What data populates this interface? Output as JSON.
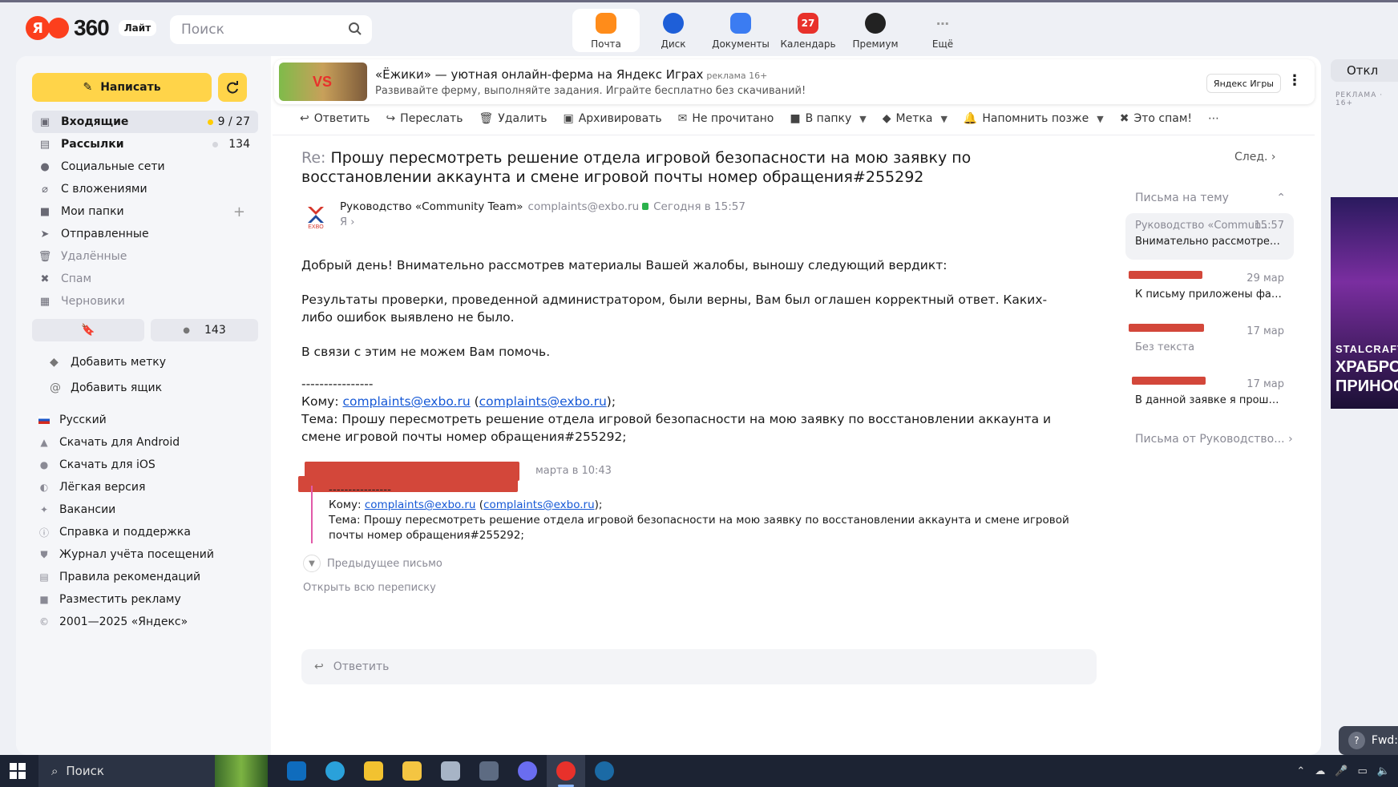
{
  "header": {
    "logo_text": "360",
    "logo_ya": "Я",
    "lite_label": "Лайт",
    "search_placeholder": "Поиск",
    "services": [
      {
        "label": "Почта",
        "icon": "mail-icon",
        "color": "#ff8c1a"
      },
      {
        "label": "Диск",
        "icon": "disk-icon",
        "color": "#1e5fd8"
      },
      {
        "label": "Документы",
        "icon": "documents-icon",
        "color": "#3b7cf2"
      },
      {
        "label": "Календарь",
        "icon": "calendar-icon",
        "color": "#e8312b",
        "badge": "27"
      },
      {
        "label": "Премиум",
        "icon": "premium-icon",
        "color": "#222222"
      },
      {
        "label": "Ещё",
        "icon": "more-icon",
        "color": "#999999"
      }
    ]
  },
  "sidebar": {
    "compose_label": "Написать",
    "folders": [
      {
        "label": "Входящие",
        "count": "9 / 27",
        "icon": "inbox-icon",
        "active": true
      },
      {
        "label": "Рассылки",
        "count": "134",
        "icon": "newsletters-icon"
      },
      {
        "label": "Социальные сети",
        "icon": "social-icon"
      },
      {
        "label": "С вложениями",
        "icon": "attachment-icon"
      },
      {
        "label": "Мои папки",
        "icon": "folder-icon"
      },
      {
        "label": "Отправленные",
        "icon": "sent-icon"
      },
      {
        "label": "Удалённые",
        "icon": "trash-icon"
      },
      {
        "label": "Спам",
        "icon": "spam-icon"
      },
      {
        "label": "Черновики",
        "icon": "drafts-icon"
      }
    ],
    "unread_count": "143",
    "add_label": "Добавить метку",
    "add_mailbox": "Добавить ящик",
    "links": [
      {
        "label": "Русский",
        "icon": "flag-ru-icon"
      },
      {
        "label": "Скачать для Android",
        "icon": "android-icon"
      },
      {
        "label": "Скачать для iOS",
        "icon": "apple-icon"
      },
      {
        "label": "Лёгкая версия",
        "icon": "light-version-icon"
      },
      {
        "label": "Вакансии",
        "icon": "jobs-icon"
      },
      {
        "label": "Справка и поддержка",
        "icon": "help-icon"
      },
      {
        "label": "Журнал учёта посещений",
        "icon": "shield-icon"
      },
      {
        "label": "Правила рекомендаций",
        "icon": "rules-icon"
      },
      {
        "label": "Разместить рекламу",
        "icon": "ad-icon"
      },
      {
        "label": "2001—2025 «Яндекс»",
        "icon": "copyright-icon"
      }
    ]
  },
  "ad": {
    "title": "«Ёжики» — уютная онлайн-ферма на Яндекс Играх",
    "ad_label": "реклама  16+",
    "subtitle": "Развивайте ферму, выполняйте задания. Играйте бесплатно без скачиваний!",
    "button": "Яндекс Игры",
    "thumb_text": "VS"
  },
  "toolbar": [
    {
      "label": "Ответить",
      "icon": "reply-icon"
    },
    {
      "label": "Переслать",
      "icon": "forward-icon"
    },
    {
      "label": "Удалить",
      "icon": "delete-icon"
    },
    {
      "label": "Архивировать",
      "icon": "archive-icon"
    },
    {
      "label": "Не прочитано",
      "icon": "unread-icon"
    },
    {
      "label": "В папку",
      "icon": "move-folder-icon",
      "dropdown": true
    },
    {
      "label": "Метка",
      "icon": "label-icon",
      "dropdown": true
    },
    {
      "label": "Напомнить позже",
      "icon": "remind-icon",
      "dropdown": true
    },
    {
      "label": "Это спам!",
      "icon": "report-spam-icon"
    }
  ],
  "message": {
    "re_prefix": "Re:",
    "subject": "Прошу пересмотреть решение отдела игровой безопасности на мою заявку по восстановлении аккаунта и смене игровой почты номер обращения#255292",
    "next_label": "След.",
    "sender_name": "Руководство «Community Team»",
    "sender_email": "complaints@exbo.ru",
    "time": "Сегодня в 15:57",
    "to_me": "Я",
    "body_greeting": "Добрый день! Внимательно рассмотрев материалы Вашей жалобы, выношу следующий вердикт:",
    "body_p2": "Результаты проверки, проведенной администратором, были верны, Вам был оглашен корректный ответ. Каких-либо ошибок выявлено не было.",
    "body_p3": "В связи с этим не можем Вам помочь.",
    "separator": "----------------",
    "to_label": "Кому:",
    "to_email": "complaints@exbo.ru",
    "to_email_paren": "complaints@exbo.ru",
    "topic_label": "Тема:",
    "topic": "Прошу пересмотреть решение отдела игровой безопасности на мою заявку по восстановлении аккаунта и смене игровой почты номер обращения#255292;",
    "quote_time": "марта в 10:43",
    "quote_sep": "----------------",
    "prev_label": "Предыдущее письмо",
    "open_all": "Открыть всю переписку",
    "reply_placeholder": "Ответить"
  },
  "thread": {
    "title": "Письма на тему",
    "items": [
      {
        "from": "Руководство «Commun...",
        "date": "15:57",
        "snippet": "Внимательно рассмотрев ма..."
      },
      {
        "from": "",
        "date": "29 мар",
        "snippet": "К письму приложены файлы ..."
      },
      {
        "from": "",
        "date": "17 мар",
        "snippet": "Без текста"
      },
      {
        "from": "",
        "date": "17 мар",
        "snippet": "В данной заявке я прошу вос..."
      }
    ],
    "more": "Письма от Руководство..."
  },
  "right": {
    "disable": "Откл",
    "ad_label": "РЕКЛАМА · 16+",
    "banner_title": "STALCRAFT",
    "banner_sub": "ХРАБРОС ПРИНОСИ",
    "fwd": "Fwd:"
  },
  "taskbar": {
    "search": "Поиск",
    "apps": [
      "outlook-icon",
      "telegram-icon",
      "app-spark-icon",
      "explorer-icon",
      "notes-icon",
      "calculator-icon",
      "discord-icon",
      "yandex-browser-icon",
      "steam-icon"
    ]
  }
}
